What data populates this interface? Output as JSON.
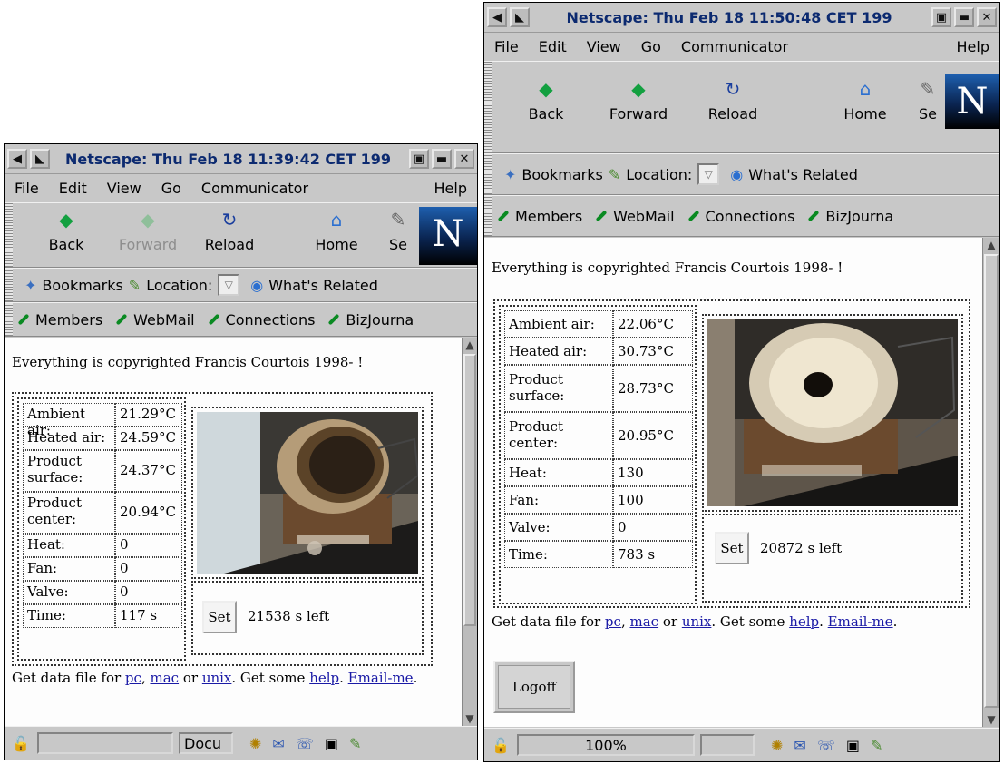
{
  "windows": [
    {
      "title": "Netscape: Thu Feb 18 11:39:42 CET 199",
      "menu": [
        "File",
        "Edit",
        "View",
        "Go",
        "Communicator",
        "Help"
      ],
      "nav": [
        "Back",
        "Forward",
        "Reload",
        "Home",
        "Se"
      ],
      "location_bar": {
        "bookmarks": "Bookmarks",
        "location": "Location:",
        "related": "What's Related"
      },
      "personal": [
        "Members",
        "WebMail",
        "Connections",
        "BizJourna"
      ],
      "copyright": "Everything is copyrighted Francis Courtois 1998- !",
      "readings": [
        {
          "label": "Ambient air:",
          "value": "21.29°C"
        },
        {
          "label": "Heated air:",
          "value": "24.59°C"
        },
        {
          "label": "Product surface:",
          "value": "24.37°C"
        },
        {
          "label": "Product center:",
          "value": "20.94°C"
        },
        {
          "label": "Heat:",
          "value": "0"
        },
        {
          "label": "Fan:",
          "value": "0"
        },
        {
          "label": "Valve:",
          "value": "0"
        },
        {
          "label": "Time:",
          "value": "117 s"
        }
      ],
      "set_label": "Set",
      "time_left": "21538 s left",
      "links_text": {
        "prefix": "Get data file for ",
        "pc": "pc",
        "mac": "mac",
        "or": " or ",
        "unix": "unix",
        "mid": ". Get some ",
        "help": "help",
        "dot": ". ",
        "email": "Email-me",
        "end": "."
      },
      "status": {
        "progress": "",
        "doc": "Docu"
      }
    },
    {
      "title": "Netscape: Thu Feb 18 11:50:48 CET 199",
      "menu": [
        "File",
        "Edit",
        "View",
        "Go",
        "Communicator",
        "Help"
      ],
      "nav": [
        "Back",
        "Forward",
        "Reload",
        "Home",
        "Se"
      ],
      "location_bar": {
        "bookmarks": "Bookmarks",
        "location": "Location:",
        "related": "What's Related"
      },
      "personal": [
        "Members",
        "WebMail",
        "Connections",
        "BizJourna"
      ],
      "copyright": "Everything is copyrighted Francis Courtois 1998- !",
      "readings": [
        {
          "label": "Ambient air:",
          "value": "22.06°C"
        },
        {
          "label": "Heated air:",
          "value": "30.73°C"
        },
        {
          "label": "Product surface:",
          "value": "28.73°C"
        },
        {
          "label": "Product center:",
          "value": "20.95°C"
        },
        {
          "label": "Heat:",
          "value": "130"
        },
        {
          "label": "Fan:",
          "value": "100"
        },
        {
          "label": "Valve:",
          "value": "0"
        },
        {
          "label": "Time:",
          "value": "783 s"
        }
      ],
      "set_label": "Set",
      "time_left": "20872 s left",
      "links_text": {
        "prefix": "Get data file for ",
        "pc": "pc",
        "mac": "mac",
        "or": " or ",
        "unix": "unix",
        "mid": ". Get some ",
        "help": "help",
        "dot": ". ",
        "email": "Email-me",
        "end": "."
      },
      "logoff_label": "Logoff",
      "status": {
        "progress": "100%",
        "doc": ""
      }
    }
  ],
  "icons": {
    "back": "back-arrow-icon",
    "forward": "forward-arrow-icon",
    "reload": "reload-icon",
    "home": "home-icon",
    "search": "search-icon",
    "bookmarks": "bookmarks-icon",
    "lock": "security-lock-icon"
  },
  "colors": {
    "title_text": "#0c2a70",
    "link": "#1a1aa6",
    "chrome": "#c8c8c8",
    "pen_green": "#0a8a22"
  }
}
